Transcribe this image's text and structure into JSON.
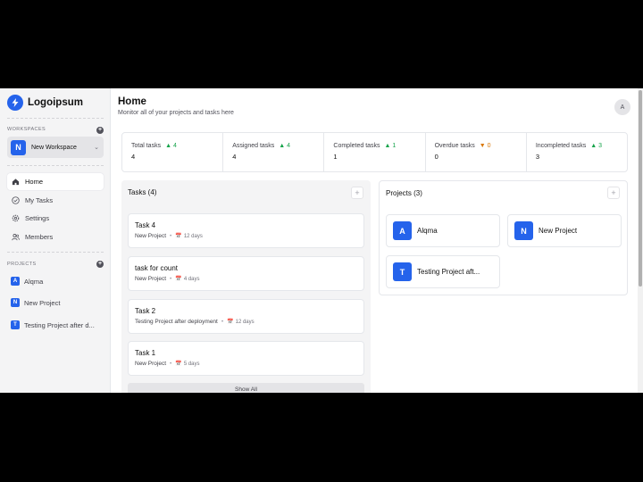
{
  "brand": {
    "name": "Logoipsum"
  },
  "sidebar": {
    "workspaces_label": "WORKSPACES",
    "workspace": {
      "initial": "N",
      "name": "New Workspace"
    },
    "nav": [
      {
        "label": "Home",
        "icon": "home-icon",
        "active": true
      },
      {
        "label": "My Tasks",
        "icon": "check-circle-icon",
        "active": false
      },
      {
        "label": "Settings",
        "icon": "gear-icon",
        "active": false
      },
      {
        "label": "Members",
        "icon": "users-icon",
        "active": false
      }
    ],
    "projects_label": "PROJECTS",
    "projects": [
      {
        "initial": "A",
        "name": "Alqma"
      },
      {
        "initial": "N",
        "name": "New Project"
      },
      {
        "initial": "T",
        "name": "Testing Project after d..."
      }
    ]
  },
  "header": {
    "title": "Home",
    "subtitle": "Monitor all of your projects and tasks here",
    "avatar_initial": "A"
  },
  "stats": [
    {
      "label": "Total tasks",
      "trend": "4",
      "direction": "up",
      "value": "4"
    },
    {
      "label": "Assigned tasks",
      "trend": "4",
      "direction": "up",
      "value": "4"
    },
    {
      "label": "Completed tasks",
      "trend": "1",
      "direction": "up",
      "value": "1"
    },
    {
      "label": "Overdue tasks",
      "trend": "0",
      "direction": "down",
      "value": "0"
    },
    {
      "label": "Incompleted tasks",
      "trend": "3",
      "direction": "up",
      "value": "3"
    }
  ],
  "tasks_panel": {
    "title": "Tasks (4)",
    "tasks": [
      {
        "title": "Task 4",
        "project": "New Project",
        "due": "12 days"
      },
      {
        "title": "task for count",
        "project": "New Project",
        "due": "4 days"
      },
      {
        "title": "Task 2",
        "project": "Testing Project after deployment",
        "due": "12 days"
      },
      {
        "title": "Task 1",
        "project": "New Project",
        "due": "5 days"
      }
    ],
    "show_all": "Show All"
  },
  "projects_panel": {
    "title": "Projects (3)",
    "projects": [
      {
        "initial": "A",
        "name": "Alqma"
      },
      {
        "initial": "N",
        "name": "New Project"
      },
      {
        "initial": "T",
        "name": "Testing Project aft..."
      }
    ]
  },
  "colors": {
    "accent": "#2563eb",
    "trend_up": "#16a34a",
    "trend_down": "#d97706"
  }
}
